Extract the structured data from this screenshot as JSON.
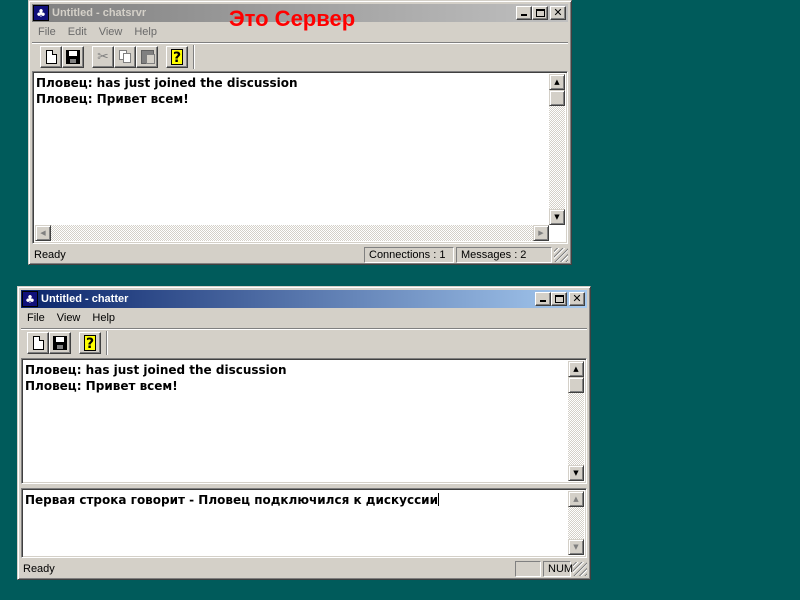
{
  "overlay_label": "Это Сервер",
  "colors": {
    "desktop": "#005b5b",
    "active_title": "#0a246a",
    "inactive_title": "#808080",
    "overlay_label": "#ff0000"
  },
  "server_window": {
    "title": "Untitled - chatsrvr",
    "menu": [
      "File",
      "Edit",
      "View",
      "Help"
    ],
    "toolbar": [
      "new-icon",
      "save-icon",
      "cut-icon",
      "copy-icon",
      "paste-icon",
      "help-icon"
    ],
    "log_lines": [
      "Пловец: has just joined the discussion",
      "Пловец: Привет всем!"
    ],
    "status": {
      "text": "Ready",
      "connections": "Connections : 1",
      "messages": "Messages : 2"
    }
  },
  "client_window": {
    "title": "Untitled - chatter",
    "menu": [
      "File",
      "View",
      "Help"
    ],
    "toolbar": [
      "new-icon",
      "save-icon",
      "help-icon"
    ],
    "log_lines": [
      "Пловец: has just joined the discussion",
      "Пловец: Привет всем!"
    ],
    "input_text": "Первая строка говорит - Пловец подключился к дискуссии",
    "status": {
      "text": "Ready",
      "num": "NUM"
    }
  }
}
